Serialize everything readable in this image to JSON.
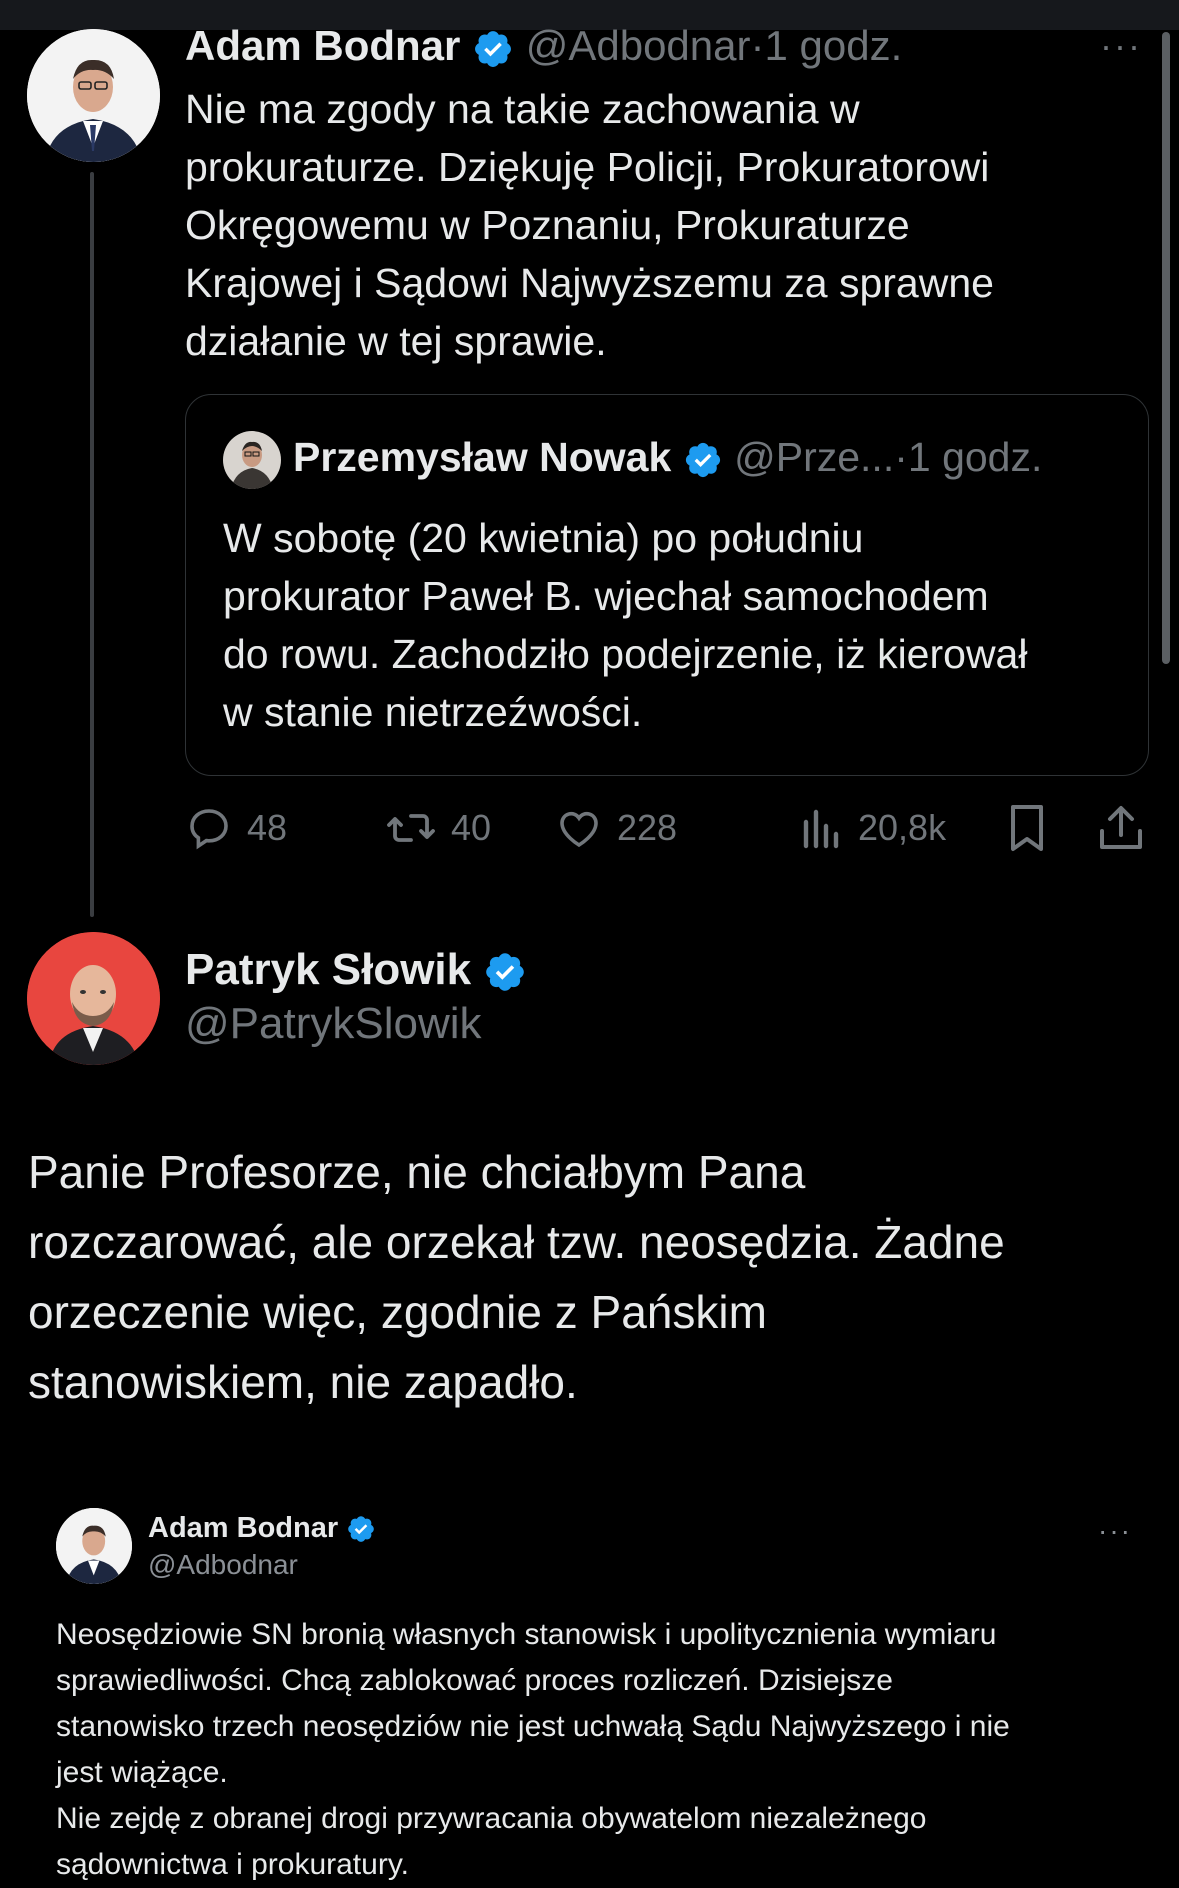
{
  "tweet1": {
    "author_name": "Adam Bodnar",
    "handle": "@Adbodnar",
    "time": "·1 godz.",
    "more": "···",
    "text": "Nie ma zgody na takie zachowania w\nprokuraturze. Dziękuję Policji, Prokuratorowi\nOkręgowemu w Poznaniu, Prokuraturze\nKrajowej i Sądowi Najwyższemu za sprawne\ndziałanie w tej sprawie."
  },
  "quote": {
    "author_name": "Przemysław Nowak",
    "handle": "@Prze...",
    "time": "·1 godz.",
    "text": "W sobotę (20 kwietnia) po południu\nprokurator Paweł B. wjechał samochodem\ndo rowu. Zachodziło podejrzenie, iż kierował\nw stanie nietrzeźwości."
  },
  "actions": {
    "replies": "48",
    "retweets": "40",
    "likes": "228",
    "views": "20,8k"
  },
  "tweet2": {
    "author_name": "Patryk Słowik",
    "handle": "@PatrykSlowik",
    "text": "Panie Profesorze, nie chciałbym Pana\nrozczarować, ale orzekał tzw. neosędzia. Żadne\norzeczenie więc, zgodnie z Pańskim\nstanowiskiem, nie zapadło."
  },
  "embedded": {
    "author_name": "Adam Bodnar",
    "handle": "@Adbodnar",
    "more": "···",
    "text": "Neosędziowie SN bronią własnych stanowisk i upolitycznienia wymiaru\nsprawiedliwości. Chcą zablokować proces rozliczeń. Dzisiejsze\nstanowisko trzech neosędziów nie jest uchwałą Sądu Najwyższego i nie\njest wiążące.\nNie zejdę z obranej drogi przywracania obywatelom niezależnego\nsądownictwa i prokuratury."
  },
  "colors": {
    "background": "#000000",
    "text": "#e7e9ea",
    "muted": "#71767b",
    "verified": "#1d9bf0",
    "avatar_red": "#e8463f"
  }
}
